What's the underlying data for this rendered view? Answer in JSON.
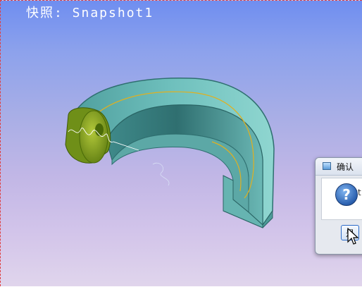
{
  "viewport": {
    "snapshot_label": "快照: Snapshot1"
  },
  "model": {
    "part_color": "#5fb3b0",
    "shaft_color": "#7a9a20"
  },
  "dialog": {
    "title": "确认",
    "icon": "question-icon",
    "icon_glyph": "?",
    "message_fragment": "t",
    "yes_label": "是"
  }
}
